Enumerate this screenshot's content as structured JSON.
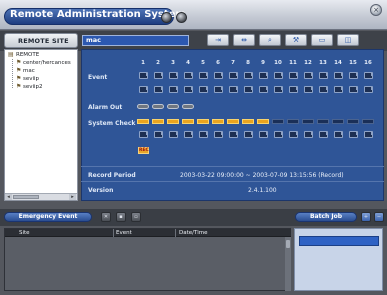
{
  "window": {
    "title": "Remote Administration System",
    "close_glyph": "×"
  },
  "toolbar": {
    "site_label": "REMOTE SITE",
    "site_value": "mac",
    "buttons": [
      {
        "icon": "login-icon",
        "glyph": "⇥"
      },
      {
        "icon": "network-icon",
        "glyph": "⇹"
      },
      {
        "icon": "search-icon",
        "glyph": "⌕"
      },
      {
        "icon": "tools-icon",
        "glyph": "⚒"
      },
      {
        "icon": "monitor-icon",
        "glyph": "▭"
      },
      {
        "icon": "camera-icon",
        "glyph": "◫"
      }
    ]
  },
  "tree": {
    "root": "REMOTE",
    "items": [
      "center/hercances",
      "mac",
      "seviip",
      "seviip2"
    ]
  },
  "status": {
    "channels": [
      "1",
      "2",
      "3",
      "4",
      "5",
      "6",
      "7",
      "8",
      "9",
      "10",
      "11",
      "12",
      "13",
      "14",
      "15",
      "16"
    ],
    "labels": {
      "event": "Event",
      "alarm_out": "Alarm Out",
      "system_check": "System Check"
    },
    "alarm_out_count": 4,
    "system_check_active": 9,
    "rec_badge": "REC",
    "record_period_label": "Record Period",
    "record_period_value": "2003-03-22 09:00:00 ~ 2003-07-09 13:15:56 (Record)",
    "version_label": "Version",
    "version_value": "2.4.1.100"
  },
  "bottom": {
    "emergency_label": "Emergency Event",
    "batch_label": "Batch Job",
    "columns": [
      "Site",
      "Event",
      "Date/Time"
    ]
  },
  "colors": {
    "accent": "#2f5597",
    "active": "#eaa420",
    "rec": "#a41a14"
  }
}
